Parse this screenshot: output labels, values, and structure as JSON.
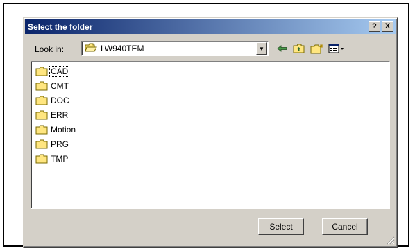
{
  "dialog": {
    "title": "Select the folder",
    "help_label": "?",
    "close_label": "X"
  },
  "lookin": {
    "label": "Look in:",
    "current_folder": "LW940TEM"
  },
  "folders": [
    {
      "label": "CAD"
    },
    {
      "label": "CMT"
    },
    {
      "label": "DOC"
    },
    {
      "label": "ERR"
    },
    {
      "label": "Motion"
    },
    {
      "label": "PRG"
    },
    {
      "label": "TMP"
    }
  ],
  "buttons": {
    "select_label": "Select",
    "cancel_label": "Cancel"
  },
  "colors": {
    "title_gradient_start": "#0a246a",
    "title_gradient_end": "#a6caf0",
    "folder_yellow": "#ffe680",
    "face": "#d4d0c8"
  },
  "icons": [
    "back-arrow-icon",
    "up-folder-icon",
    "new-folder-icon",
    "view-menu-icon"
  ]
}
